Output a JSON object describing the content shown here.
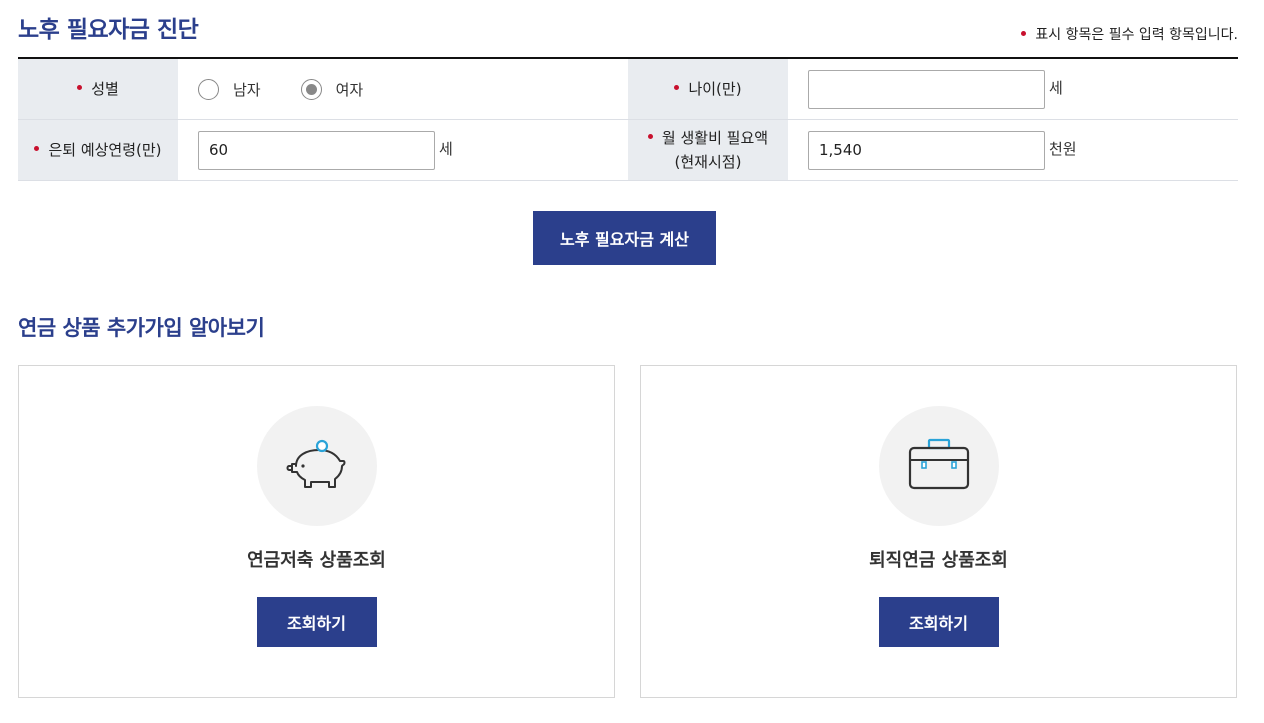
{
  "header": {
    "title": "노후 필요자금 진단",
    "required_note": "표시 항목은 필수 입력 항목입니다."
  },
  "form": {
    "gender": {
      "label": "성별",
      "options": [
        {
          "label": "남자",
          "checked": false
        },
        {
          "label": "여자",
          "checked": true
        }
      ]
    },
    "age": {
      "label": "나이(만)",
      "value": "",
      "unit": "세"
    },
    "retire_age": {
      "label": "은퇴 예상연령(만)",
      "value": "60",
      "unit": "세"
    },
    "living_cost": {
      "label_line1": "월 생활비 필요액",
      "label_line2": "(현재시점)",
      "value": "1,540",
      "unit": "천원"
    }
  },
  "calc_button": "노후 필요자금 계산",
  "section": {
    "title": "연금 상품 추가가입 알아보기",
    "cards": [
      {
        "title": "연금저축 상품조회",
        "button": "조회하기",
        "icon": "piggy-bank-icon"
      },
      {
        "title": "퇴직연금 상품조회",
        "button": "조회하기",
        "icon": "briefcase-icon"
      }
    ]
  },
  "colors": {
    "brand": "#2b3f8c",
    "required_dot": "#c8102e",
    "label_bg": "#e9ecf0",
    "icon_accent": "#2aa3d8"
  }
}
